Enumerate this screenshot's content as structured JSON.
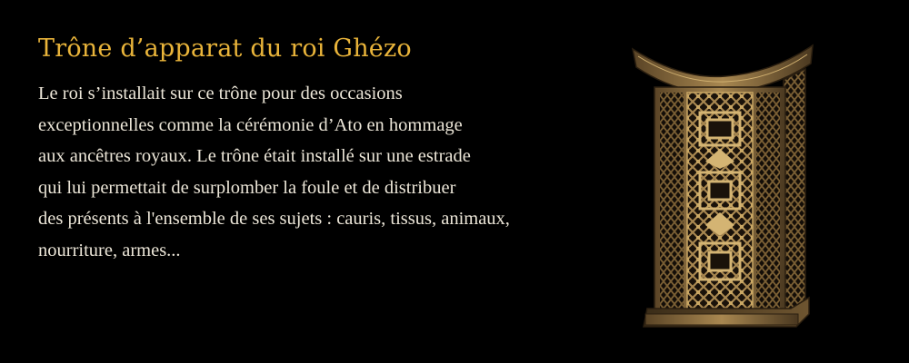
{
  "slide": {
    "title": "Trône d’apparat du roi Ghézo",
    "body_lines": [
      "Le roi s’installait sur ce trône pour des occasions",
      "exceptionnelles comme la cérémonie d’Ato en hommage",
      "aux ancêtres royaux. Le trône était installé sur une estrade",
      "qui lui permettait de surplomber la foule et de distribuer",
      "des présents à l'ensemble de ses sujets : cauris, tissus, animaux,",
      "nourriture, armes..."
    ],
    "image": {
      "icon": "throne-photo-icon"
    }
  },
  "colors": {
    "background": "#000000",
    "title": "#e9b43a",
    "body": "#ece6d8",
    "wood": "#8a6a3c"
  }
}
